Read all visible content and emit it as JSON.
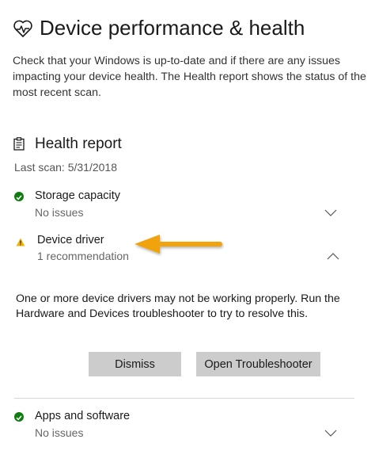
{
  "header": {
    "title": "Device performance & health",
    "description": "Check that your Windows is up-to-date and if there are any issues impacting your device health. The Health report shows the status of the most recent scan."
  },
  "health_report": {
    "title": "Health report",
    "last_scan": "Last scan: 5/31/2018",
    "items": [
      {
        "label": "Storage capacity",
        "status": "No issues",
        "state": "ok",
        "expanded": false
      },
      {
        "label": "Device driver",
        "status": "1 recommendation",
        "state": "warning",
        "expanded": true,
        "message": "One or more device drivers may not be working properly. Run the Hardware and Devices troubleshooter to try to resolve this.",
        "dismiss_label": "Dismiss",
        "troubleshooter_label": "Open Troubleshooter"
      },
      {
        "label": "Apps and software",
        "status": "No issues",
        "state": "ok",
        "expanded": false
      }
    ]
  },
  "colors": {
    "ok": "#107c10",
    "warning": "#f2b600",
    "annotation_arrow": "#f0a30a",
    "button_bg": "#cccccc"
  },
  "icons": {
    "title": "heart-pulse-icon",
    "section": "clipboard-icon",
    "ok": "checkmark-circle-icon",
    "warning": "warning-triangle-icon",
    "collapse": "chevron-up-icon",
    "expand": "chevron-down-icon"
  }
}
